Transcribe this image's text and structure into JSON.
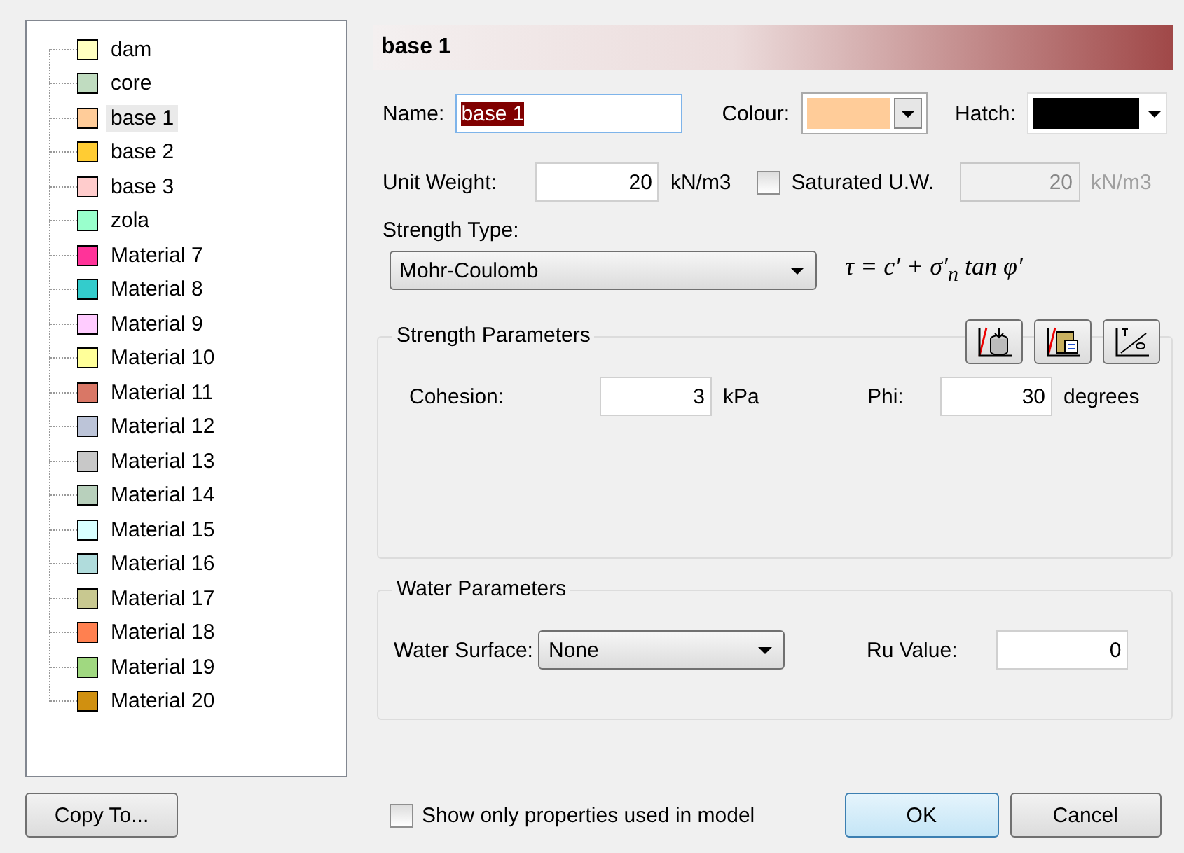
{
  "materials": [
    {
      "label": "dam",
      "color": "#ffffc0",
      "selected": false
    },
    {
      "label": "core",
      "color": "#c0dcc0",
      "selected": false
    },
    {
      "label": "base 1",
      "color": "#ffcc99",
      "selected": true
    },
    {
      "label": "base 2",
      "color": "#ffcc33",
      "selected": false
    },
    {
      "label": "base 3",
      "color": "#ffcccc",
      "selected": false
    },
    {
      "label": "zola",
      "color": "#99ffcc",
      "selected": false
    },
    {
      "label": "Material 7",
      "color": "#ff3399",
      "selected": false
    },
    {
      "label": "Material 8",
      "color": "#33cccc",
      "selected": false
    },
    {
      "label": "Material 9",
      "color": "#ffccff",
      "selected": false
    },
    {
      "label": "Material 10",
      "color": "#ffff99",
      "selected": false
    },
    {
      "label": "Material 11",
      "color": "#d97766",
      "selected": false
    },
    {
      "label": "Material 12",
      "color": "#bcc4d8",
      "selected": false
    },
    {
      "label": "Material 13",
      "color": "#c8c8c8",
      "selected": false
    },
    {
      "label": "Material 14",
      "color": "#b8d0bc",
      "selected": false
    },
    {
      "label": "Material 15",
      "color": "#d8ffff",
      "selected": false
    },
    {
      "label": "Material 16",
      "color": "#b0dcdc",
      "selected": false
    },
    {
      "label": "Material 17",
      "color": "#c8c890",
      "selected": false
    },
    {
      "label": "Material 18",
      "color": "#ff8050",
      "selected": false
    },
    {
      "label": "Material 19",
      "color": "#a0d880",
      "selected": false
    },
    {
      "label": "Material 20",
      "color": "#d09010",
      "selected": false
    }
  ],
  "header": {
    "title": "base 1"
  },
  "name": {
    "label": "Name:",
    "value": "base 1"
  },
  "colour": {
    "label": "Colour:",
    "color": "#ffcc99"
  },
  "hatch": {
    "label": "Hatch:",
    "color": "#000000"
  },
  "unit_weight": {
    "label": "Unit Weight:",
    "value": "20",
    "unit": "kN/m3"
  },
  "saturated": {
    "label": "Saturated U.W.",
    "checked": false,
    "value": "20",
    "unit": "kN/m3"
  },
  "strength_type": {
    "label": "Strength Type:",
    "value": "Mohr-Coulomb",
    "formula": "τ = c′ + σ′$_{n}$ tan φ′"
  },
  "strength_parameters": {
    "title": "Strength Parameters",
    "fields": [
      {
        "label": "Cohesion:",
        "value": "3",
        "unit": "kPa"
      },
      {
        "label": "Phi:",
        "value": "30",
        "unit": "degrees"
      }
    ]
  },
  "water_parameters": {
    "title": "Water Parameters",
    "surface_label": "Water Surface:",
    "surface_value": "None",
    "ru_label": "Ru Value:",
    "ru_value": "0"
  },
  "footer": {
    "copy_button": "Copy To...",
    "show_only": {
      "label": "Show only properties used in model",
      "checked": false
    },
    "ok": "OK",
    "cancel": "Cancel"
  }
}
